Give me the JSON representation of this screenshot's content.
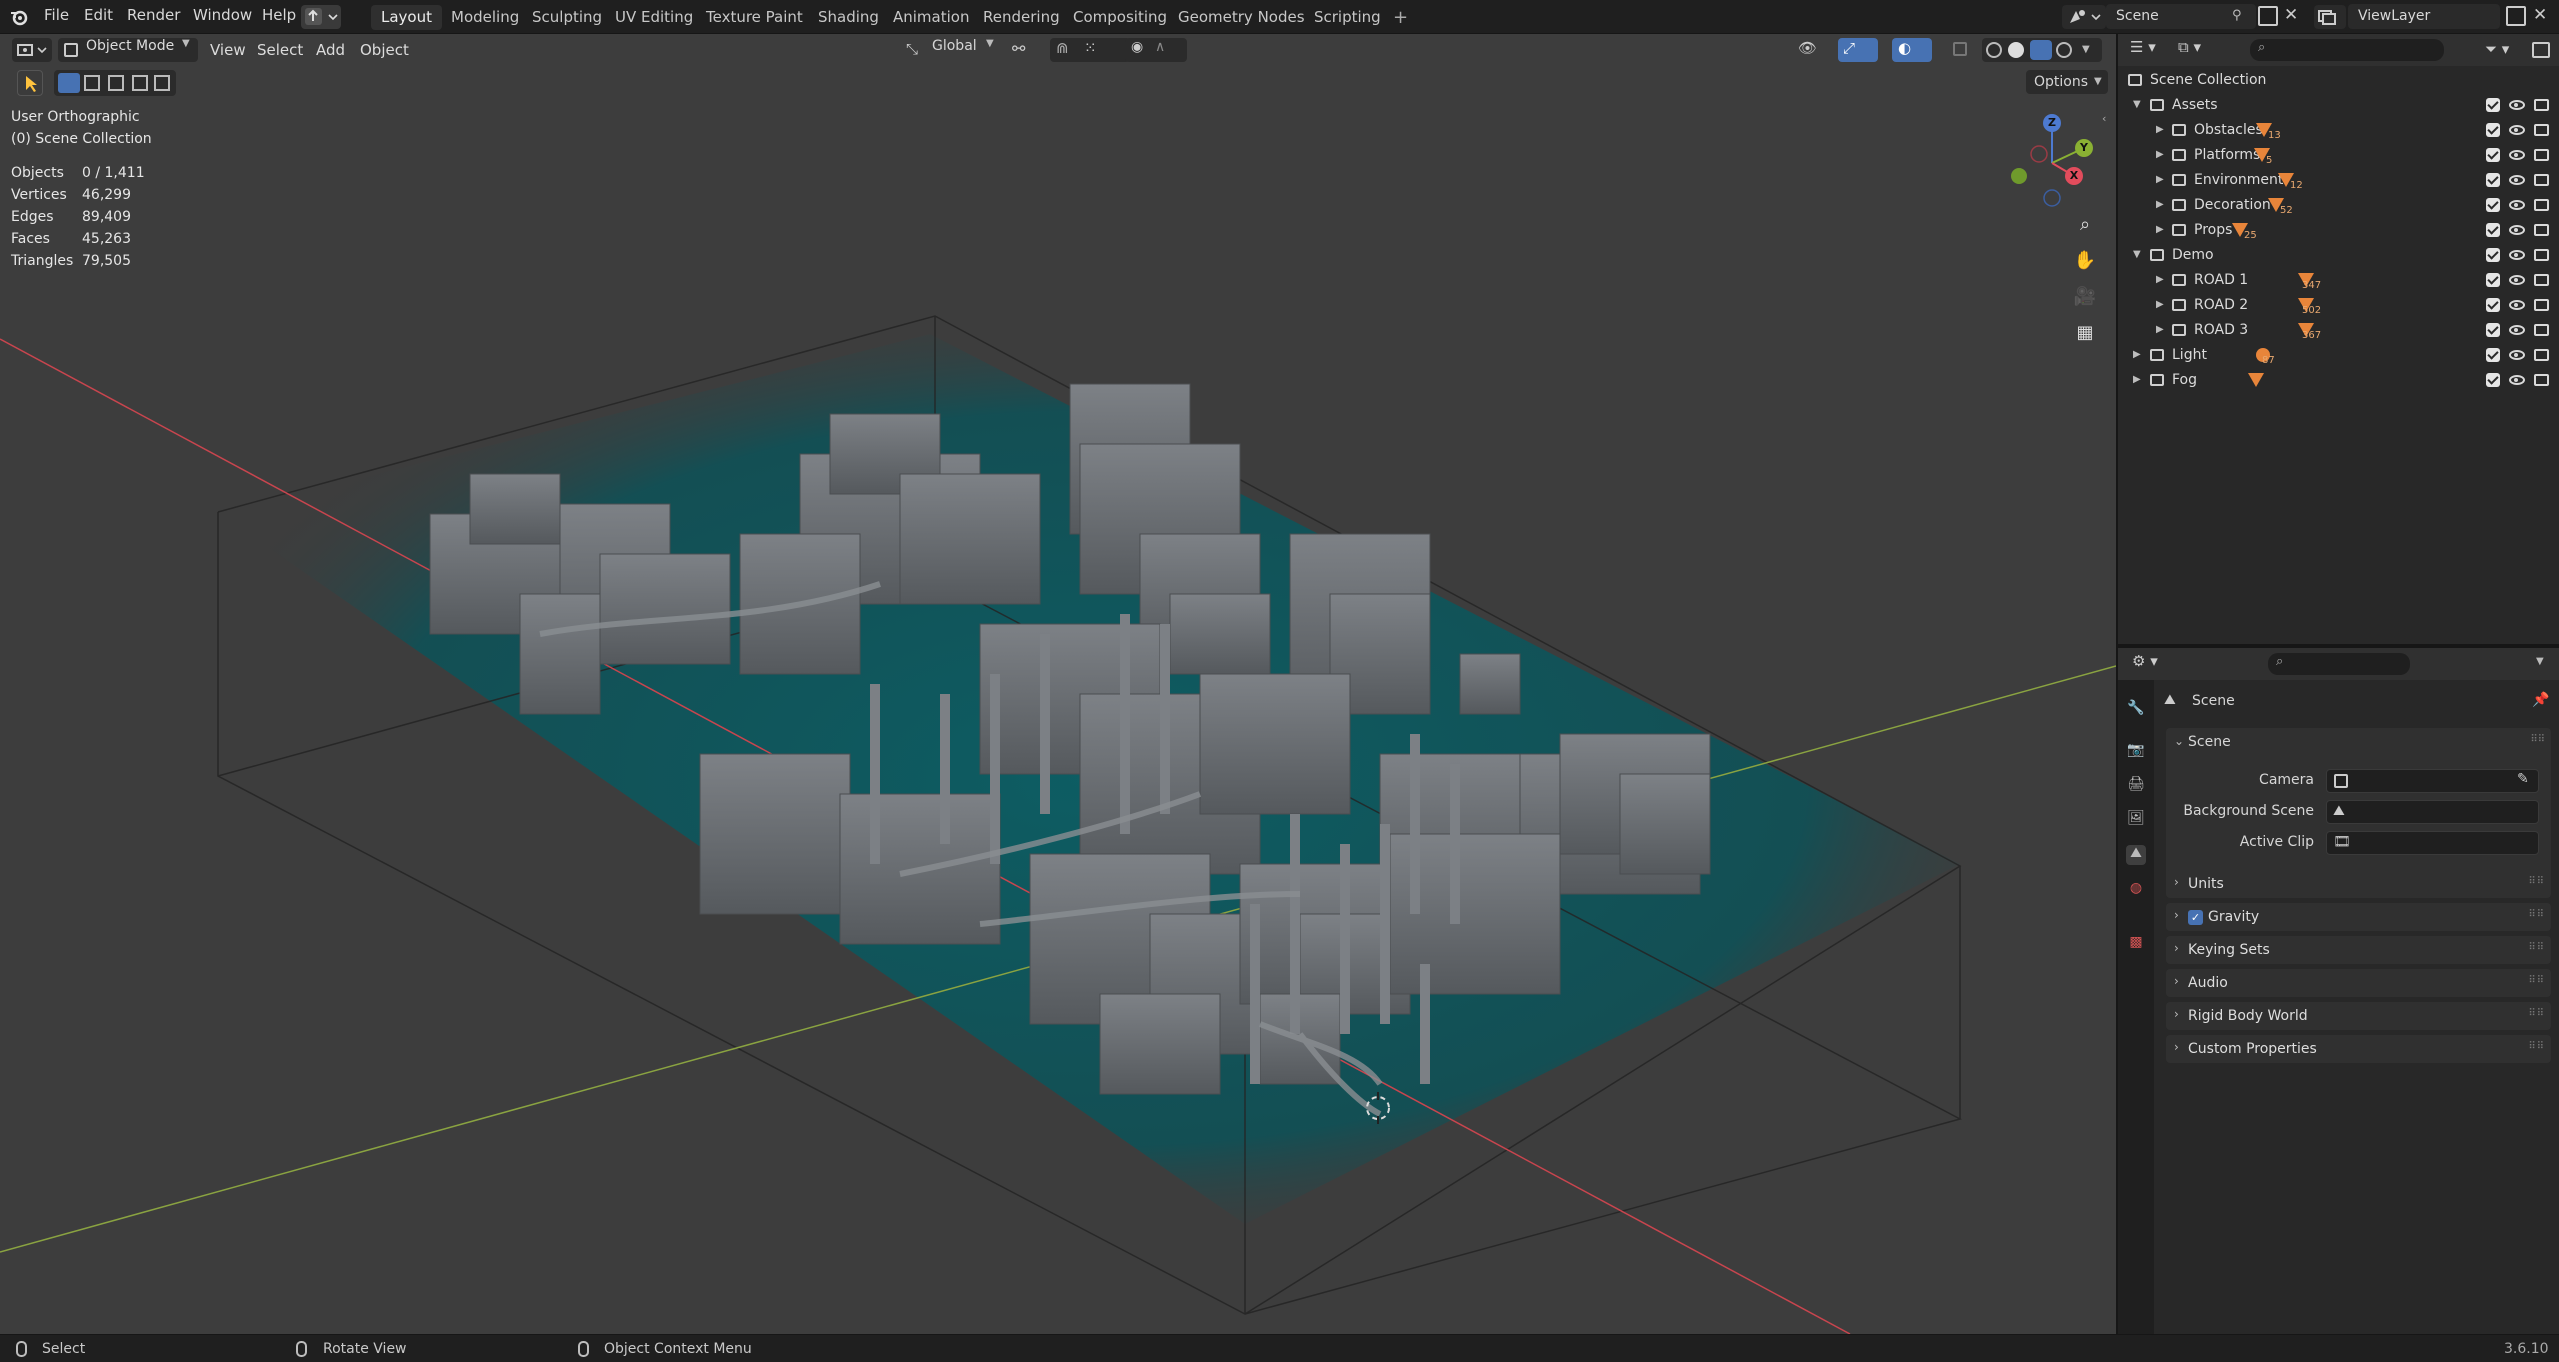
{
  "topbar": {
    "menus": [
      "File",
      "Edit",
      "Render",
      "Window",
      "Help"
    ],
    "workspaces": [
      "Layout",
      "Modeling",
      "Sculpting",
      "UV Editing",
      "Texture Paint",
      "Shading",
      "Animation",
      "Rendering",
      "Compositing",
      "Geometry Nodes",
      "Scripting"
    ],
    "active_workspace": "Layout",
    "add_tab": "+",
    "scene_name": "Scene",
    "view_layer": "ViewLayer"
  },
  "viewport_header": {
    "mode": "Object Mode",
    "menus": [
      "View",
      "Select",
      "Add",
      "Object"
    ],
    "transform_orientation": "Global",
    "options": "Options"
  },
  "overlay_text": {
    "view_name": "User Orthographic",
    "collection": "(0) Scene Collection",
    "stats": [
      {
        "label": "Objects",
        "value": "0 / 1,411"
      },
      {
        "label": "Vertices",
        "value": "46,299"
      },
      {
        "label": "Edges",
        "value": "89,409"
      },
      {
        "label": "Faces",
        "value": "45,263"
      },
      {
        "label": "Triangles",
        "value": "79,505"
      }
    ]
  },
  "gizmo": {
    "z": "Z",
    "y": "Y",
    "x": "X"
  },
  "outliner": {
    "root": "Scene Collection",
    "rows": [
      {
        "label": "Assets",
        "depth": 1,
        "expanded": true,
        "badge": ""
      },
      {
        "label": "Obstacles",
        "depth": 2,
        "expanded": false,
        "badge": "13"
      },
      {
        "label": "Platforms",
        "depth": 2,
        "expanded": false,
        "badge": "5"
      },
      {
        "label": "Environment",
        "depth": 2,
        "expanded": false,
        "badge": "12"
      },
      {
        "label": "Decoration",
        "depth": 2,
        "expanded": false,
        "badge": "52"
      },
      {
        "label": "Props",
        "depth": 2,
        "expanded": false,
        "badge": "25"
      },
      {
        "label": "Demo",
        "depth": 1,
        "expanded": true,
        "badge": ""
      },
      {
        "label": "ROAD 1",
        "depth": 2,
        "expanded": false,
        "badge": "347"
      },
      {
        "label": "ROAD 2",
        "depth": 2,
        "expanded": false,
        "badge": "502"
      },
      {
        "label": "ROAD 3",
        "depth": 2,
        "expanded": false,
        "badge": "367"
      },
      {
        "label": "Light",
        "depth": 1,
        "expanded": false,
        "badge": "87"
      },
      {
        "label": "Fog",
        "depth": 1,
        "expanded": false,
        "badge": ""
      }
    ]
  },
  "properties": {
    "context_title": "Scene",
    "panel_title": "Scene",
    "fields": [
      {
        "label": "Camera"
      },
      {
        "label": "Background Scene"
      },
      {
        "label": "Active Clip"
      }
    ],
    "subpanels": [
      "Units",
      "Gravity",
      "Keying Sets",
      "Audio",
      "Rigid Body World",
      "Custom Properties"
    ],
    "gravity_checked": true
  },
  "statusbar": {
    "select": "Select",
    "rotate": "Rotate View",
    "context_menu": "Object Context Menu",
    "version": "3.6.10"
  },
  "colors": {
    "accent_blue": "#4772b3",
    "x_axis": "#c8454e",
    "y_axis": "#8aa341",
    "fog_teal": "#0d5d63",
    "badge_orange": "#e8853a"
  }
}
